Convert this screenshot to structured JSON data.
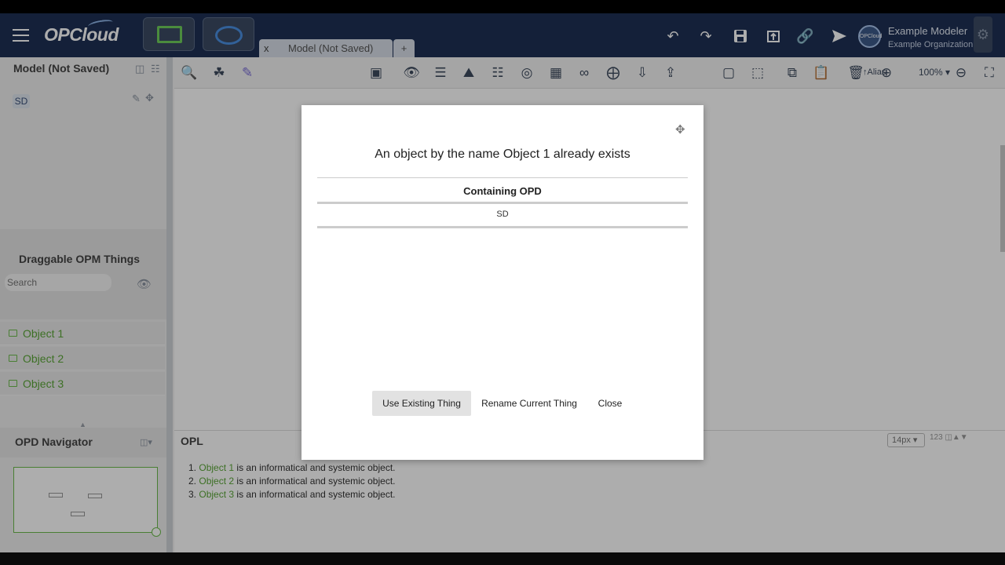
{
  "header": {
    "app_name": "OPCloud",
    "tab_close": "x",
    "tab_label": "Model (Not Saved)",
    "tab_add": "+",
    "user_name": "Example Modeler",
    "user_org": "Example Organization",
    "avatar_text": "OPCloud"
  },
  "toolbar": {
    "alias_label": "Alias",
    "zoom_value": "100%"
  },
  "left_panel": {
    "model_title": "Model (Not Saved)",
    "opd_tree": [
      "SD"
    ],
    "draggable_title": "Draggable OPM Things",
    "search_placeholder": "Search",
    "objects": [
      "Object 1",
      "Object 2",
      "Object 3"
    ],
    "navigator_title": "OPD Navigator"
  },
  "opl": {
    "title": "OPL",
    "font_size": "14px",
    "size_badge": "123",
    "sentences": [
      {
        "num": "1.",
        "object": "Object 1",
        "text": " is an informatical and systemic object."
      },
      {
        "num": "2.",
        "object": "Object 2",
        "text": " is an informatical and systemic object."
      },
      {
        "num": "3.",
        "object": "Object 3",
        "text": " is an informatical and systemic object."
      }
    ]
  },
  "dialog": {
    "title": "An object by the name Object 1 already exists",
    "column_header": "Containing OPD",
    "rows": [
      "SD"
    ],
    "use_existing_label": "Use Existing Thing",
    "rename_label": "Rename Current Thing",
    "close_label": "Close"
  },
  "colors": {
    "header_bg": "#1e3054",
    "object_green": "#5aa637",
    "process_blue": "#4a90e2"
  },
  "icons": {
    "header": [
      "menu-icon",
      "undo-icon",
      "redo-icon",
      "save-icon",
      "export-icon",
      "link-icon",
      "send-icon",
      "gear-icon"
    ],
    "dialog": [
      "move-icon"
    ]
  }
}
